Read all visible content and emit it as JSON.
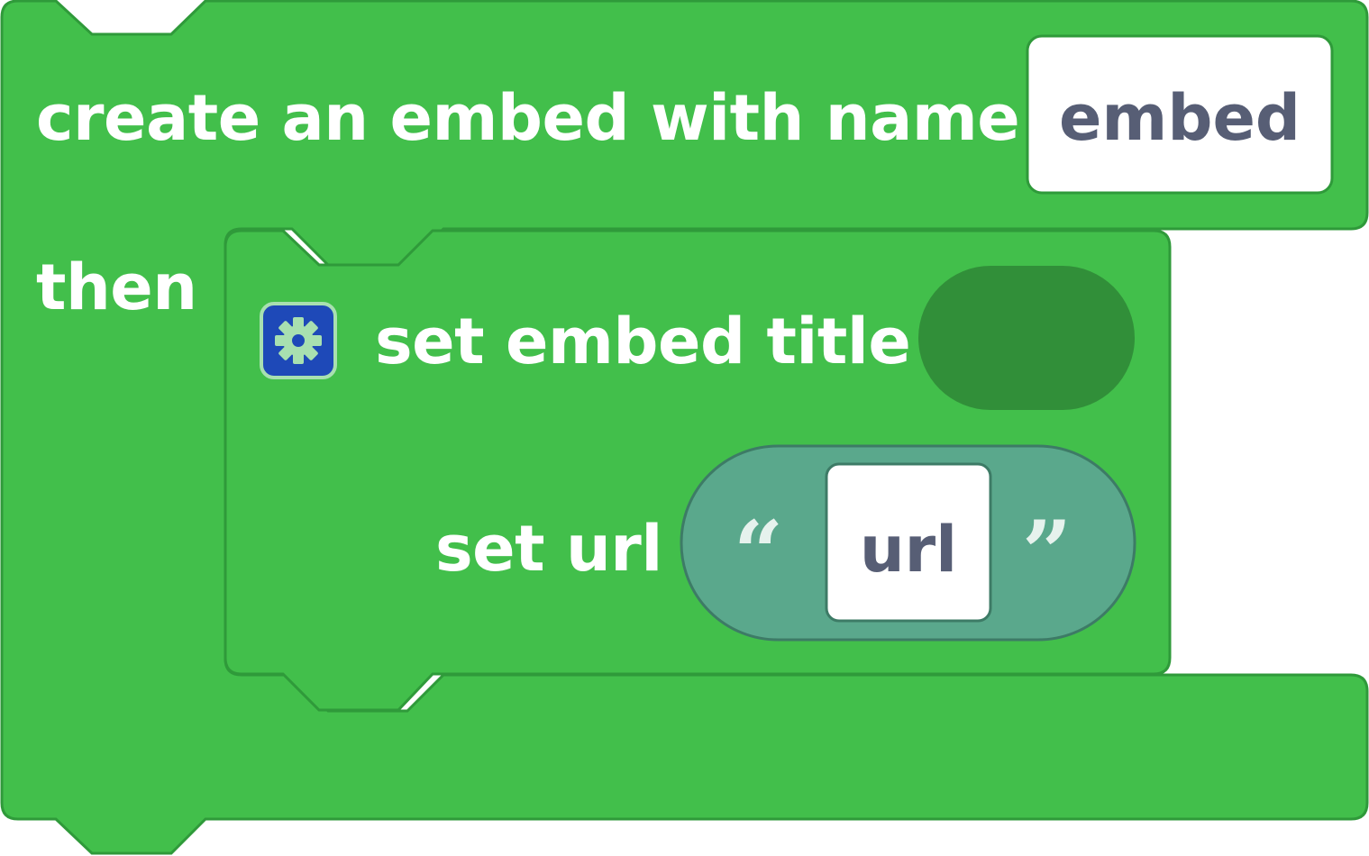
{
  "colors": {
    "block_fill": "#42bf4b",
    "block_stroke": "#2f9a3a",
    "empty_slot": "#318f39",
    "text_block_fill": "#5aa88c",
    "text_block_stroke": "#3d7b66",
    "field_fill": "#ffffff",
    "field_text": "#575e75",
    "gear_bg": "#1e49b8",
    "gear_icon": "#a8e0b0"
  },
  "outer_block": {
    "label": "create an embed  with name",
    "name_field_value": "embed",
    "then_label": "then"
  },
  "inner_block": {
    "icon": "gear-icon",
    "title_label": "set embed title",
    "url_label": "set url",
    "url_text": {
      "open_quote": "“",
      "value": "url",
      "close_quote": "”"
    }
  }
}
